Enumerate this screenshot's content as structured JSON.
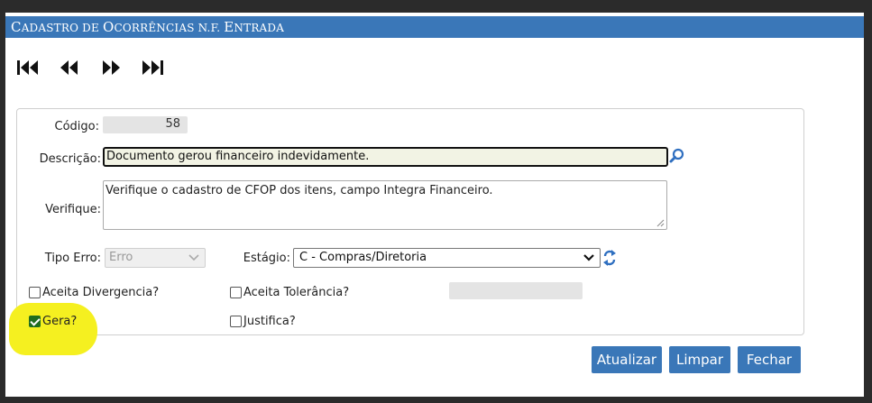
{
  "window": {
    "title_first": "C",
    "title_rest": "ADASTRO DE ",
    "title_o": "O",
    "title_rest2": "CORRÊNCIAS N.F. ",
    "title_e": "E",
    "title_rest3": "NTRADA"
  },
  "nav": {
    "icons": [
      "first-record-icon",
      "previous-record-icon",
      "next-record-icon",
      "last-record-icon"
    ]
  },
  "form": {
    "codigo_label": "Código:",
    "codigo_value": "58",
    "descricao_label": "Descrição:",
    "descricao_value": "Documento gerou financeiro indevidamente.",
    "verifique_label": "Verifique:",
    "verifique_value": "Verifique o cadastro de CFOP dos itens, campo Integra Financeiro.",
    "tipo_erro_label": "Tipo Erro:",
    "tipo_erro_value": "Erro",
    "estagio_label": "Estágio:",
    "estagio_value": "C - Compras/Diretoria",
    "aceita_divergencia_label": "Aceita Divergencia?",
    "aceita_divergencia_checked": false,
    "aceita_tolerancia_label": "Aceita Tolerância?",
    "aceita_tolerancia_checked": false,
    "gera_label": "Gera?",
    "gera_checked": true,
    "justifica_label": "Justifica?",
    "justifica_checked": false
  },
  "buttons": {
    "atualizar": "Atualizar",
    "limpar": "Limpar",
    "fechar": "Fechar"
  },
  "colors": {
    "accent": "#3a77b8",
    "highlight": "#f5f020",
    "checkbox_checked": "#1f6d1f"
  }
}
